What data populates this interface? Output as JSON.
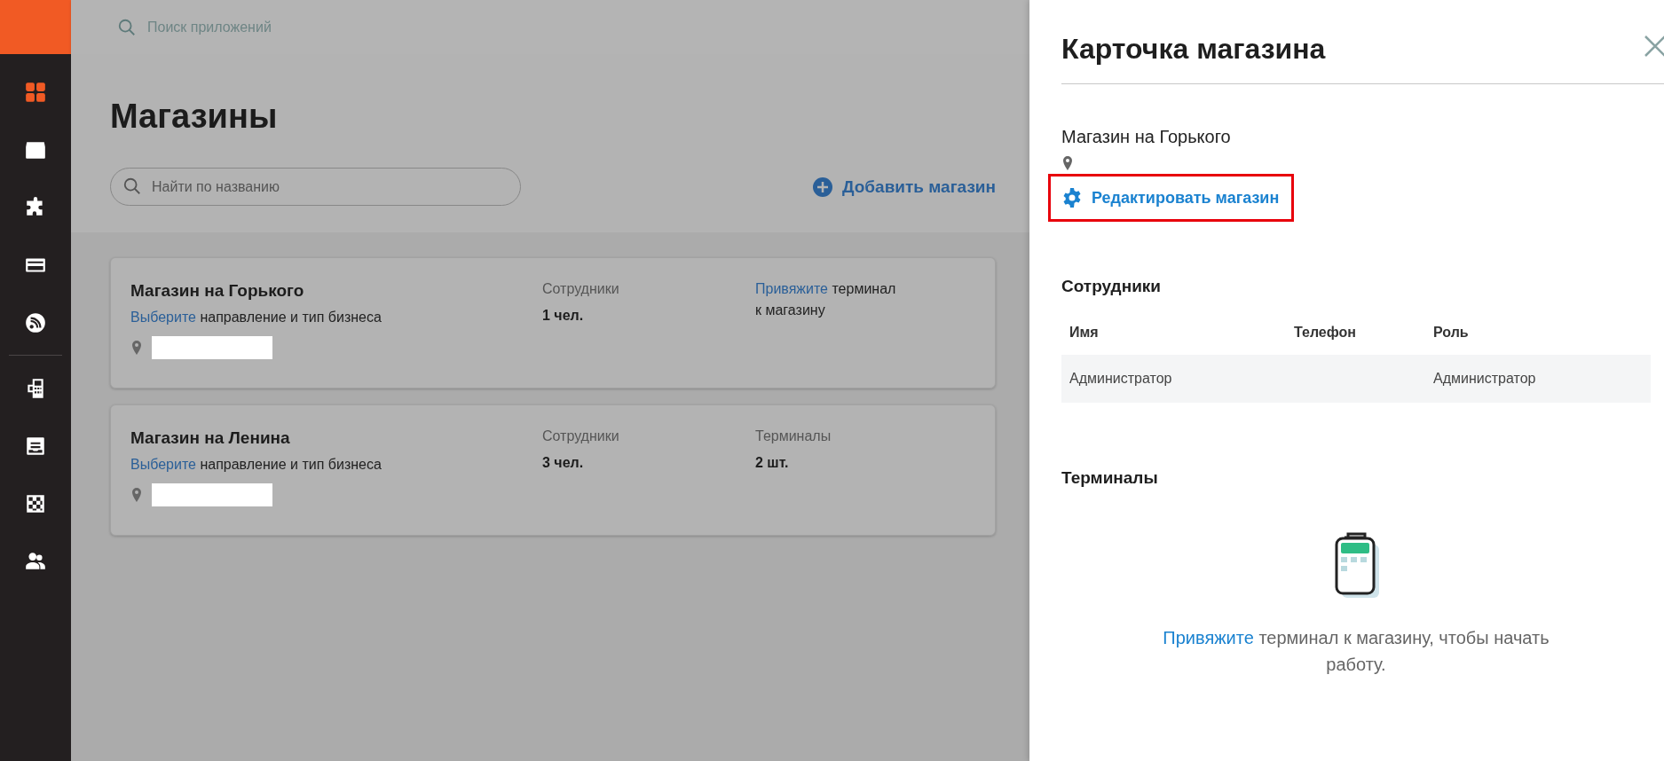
{
  "sidebar": {
    "groups": [
      [
        {
          "selected": true
        },
        {
          "selected": false
        },
        {
          "selected": false
        },
        {
          "selected": false
        },
        {
          "selected": false
        }
      ],
      [
        {
          "selected": false
        },
        {
          "selected": false
        },
        {
          "selected": false
        },
        {
          "selected": false
        }
      ]
    ]
  },
  "app_search": {
    "placeholder": "Поиск приложений"
  },
  "page": {
    "title": "Магазины",
    "search": {
      "placeholder": "Найти по названию"
    },
    "add_button": "Добавить магазин"
  },
  "stores": [
    {
      "name": "Магазин на Горького",
      "business_link": "Выберите",
      "business_text": "направление и тип бизнеса",
      "employees_label": "Сотрудники",
      "employees_value": "1 чел.",
      "terminals": {
        "kind": "link",
        "link": "Привяжите",
        "text": "терминал к магазину"
      }
    },
    {
      "name": "Магазин на Ленина",
      "business_link": "Выберите",
      "business_text": "направление и тип бизнеса",
      "employees_label": "Сотрудники",
      "employees_value": "3 чел.",
      "terminals": {
        "kind": "stat",
        "label": "Терминалы",
        "value": "2 шт."
      }
    }
  ],
  "panel": {
    "title": "Карточка магазина",
    "store_name": "Магазин на Горького",
    "edit_button": {
      "label": "Редактировать магазин",
      "highlighted": true
    },
    "employees": {
      "heading": "Сотрудники",
      "columns": [
        "Имя",
        "Телефон",
        "Роль"
      ],
      "rows": [
        {
          "name": "Администратор",
          "role": "Администратор"
        }
      ]
    },
    "terminals": {
      "heading": "Терминалы",
      "empty_link": "Привяжите",
      "empty_text": "терминал к магазину, чтобы начать работу."
    }
  }
}
